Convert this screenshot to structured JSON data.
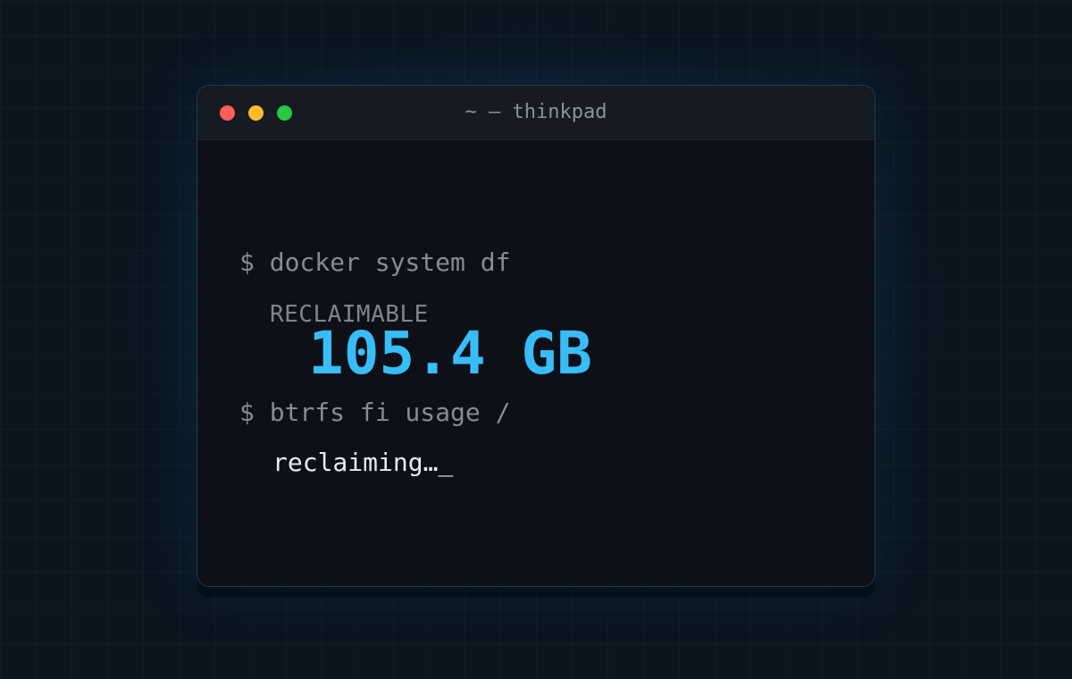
{
  "window": {
    "title": "~ — thinkpad",
    "controls": {
      "close_color": "#ff5f57",
      "minimize_color": "#febc2e",
      "maximize_color": "#28c840"
    }
  },
  "terminal": {
    "command_1": "$ docker system df",
    "reclaimable_label": "RECLAIMABLE",
    "reclaimable_value": "105.4 GB",
    "command_2": "$ btrfs fi usage /",
    "status_text": "reclaiming…",
    "cursor": "_",
    "accent_color": "#38bdf8"
  }
}
